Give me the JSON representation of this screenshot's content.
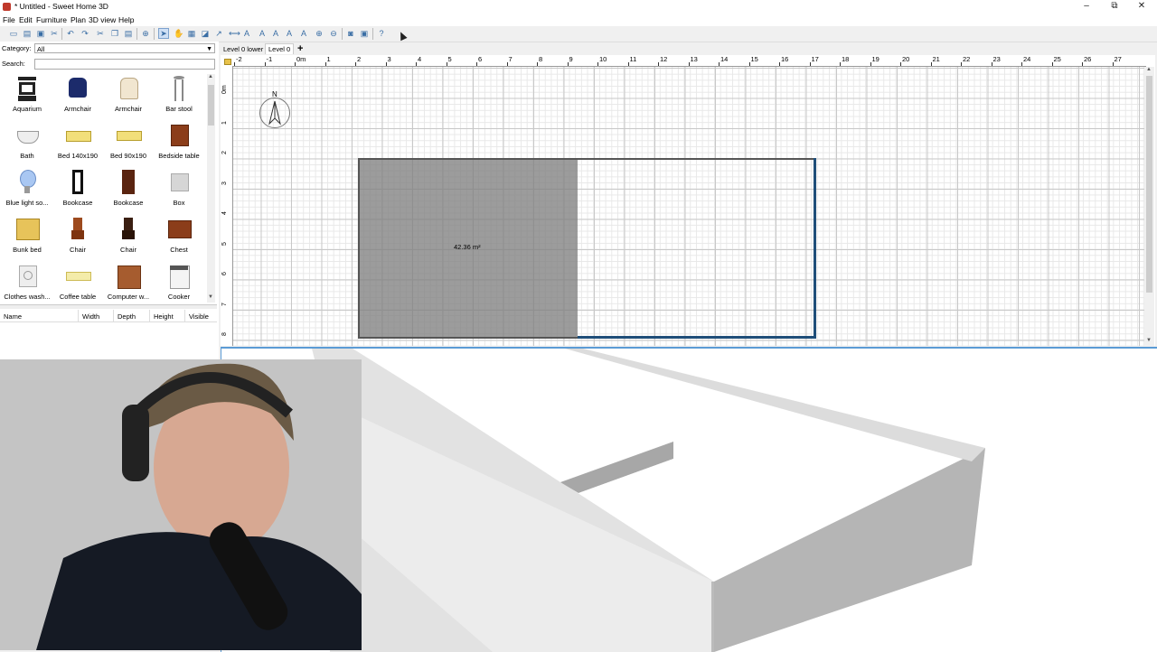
{
  "window": {
    "title": "* Untitled - Sweet Home 3D",
    "minimize": "–",
    "maximize": "⧉",
    "close": "✕"
  },
  "menu": [
    "File",
    "Edit",
    "Furniture",
    "Plan",
    "3D view",
    "Help"
  ],
  "toolbar": {
    "buttons": [
      "new-home-icon",
      "open-icon",
      "save-icon",
      "cut-icon",
      "add-furniture-icon",
      "undo-icon",
      "redo-icon",
      "cut2-icon",
      "copy-icon",
      "paste-icon",
      "add-icon",
      "select-icon",
      "pan-icon",
      "create-walls-icon",
      "create-rooms-icon",
      "create-polylines-icon",
      "create-dimensions-icon",
      "add-text-icon",
      "increase-text-icon",
      "decrease-text-icon",
      "bold-icon",
      "italic-icon",
      "zoom-in-icon",
      "zoom-out-icon",
      "create-photo-icon",
      "create-video-icon",
      "help-icon"
    ],
    "active": "select-icon"
  },
  "catalog": {
    "category_label": "Category:",
    "category_value": "All",
    "search_label": "Search:",
    "search_value": "",
    "items": [
      {
        "name": "Aquarium",
        "icon": "aquarium-icon"
      },
      {
        "name": "Armchair",
        "icon": "armchair-blue-icon"
      },
      {
        "name": "Armchair",
        "icon": "armchair-white-icon"
      },
      {
        "name": "Bar stool",
        "icon": "bar-stool-icon"
      },
      {
        "name": "Bath",
        "icon": "bath-icon"
      },
      {
        "name": "Bed 140x190",
        "icon": "bed-double-icon"
      },
      {
        "name": "Bed 90x190",
        "icon": "bed-single-icon"
      },
      {
        "name": "Bedside table",
        "icon": "bedside-table-icon"
      },
      {
        "name": "Blue light so...",
        "icon": "light-bulb-icon"
      },
      {
        "name": "Bookcase",
        "icon": "bookcase-icon"
      },
      {
        "name": "Bookcase",
        "icon": "bookcase-wood-icon"
      },
      {
        "name": "Box",
        "icon": "box-icon"
      },
      {
        "name": "Bunk bed",
        "icon": "bunk-bed-icon"
      },
      {
        "name": "Chair",
        "icon": "chair-icon"
      },
      {
        "name": "Chair",
        "icon": "chair-dark-icon"
      },
      {
        "name": "Chest",
        "icon": "chest-icon"
      },
      {
        "name": "Clothes wash...",
        "icon": "washer-icon"
      },
      {
        "name": "Coffee table",
        "icon": "coffee-table-icon"
      },
      {
        "name": "Computer w...",
        "icon": "computer-desk-icon"
      },
      {
        "name": "Cooker",
        "icon": "cooker-icon"
      }
    ]
  },
  "furniture_table": {
    "columns": [
      "Name",
      "Width",
      "Depth",
      "Height",
      "Visible"
    ]
  },
  "plan": {
    "tabs": [
      "Level 0 lower",
      "Level 0"
    ],
    "selected_tab": "Level 0",
    "add_level": "+",
    "ruler_x": [
      "-2",
      "-1",
      "0m",
      "1",
      "2",
      "3",
      "4",
      "5",
      "6",
      "7",
      "8",
      "9",
      "10",
      "11",
      "12",
      "13",
      "14",
      "15",
      "16",
      "17",
      "18",
      "19",
      "20",
      "21",
      "22",
      "23",
      "24",
      "25",
      "26",
      "27"
    ],
    "ruler_y": [
      "0m",
      "1",
      "2",
      "3",
      "4",
      "5",
      "6",
      "7",
      "8"
    ],
    "room_area": "42.36 m²",
    "compass_label": "N"
  },
  "colors": {
    "room_fill": "#8a8a8a",
    "wall_selected": "#1f4e79",
    "view_border": "#5b9bd5",
    "wall_3d_top": "#ffffff",
    "wall_3d_side": "#cfcfcf"
  }
}
